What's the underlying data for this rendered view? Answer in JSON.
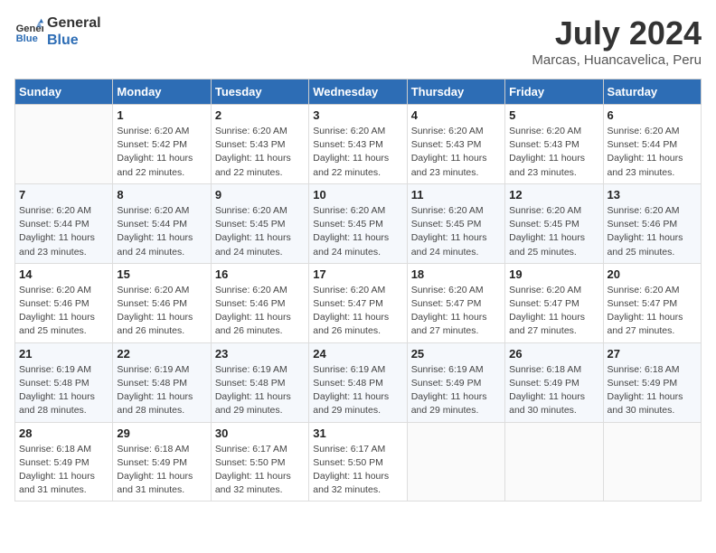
{
  "logo": {
    "line1": "General",
    "line2": "Blue"
  },
  "header": {
    "month_year": "July 2024",
    "location": "Marcas, Huancavelica, Peru"
  },
  "weekdays": [
    "Sunday",
    "Monday",
    "Tuesday",
    "Wednesday",
    "Thursday",
    "Friday",
    "Saturday"
  ],
  "weeks": [
    [
      {
        "day": "",
        "info": ""
      },
      {
        "day": "1",
        "info": "Sunrise: 6:20 AM\nSunset: 5:42 PM\nDaylight: 11 hours\nand 22 minutes."
      },
      {
        "day": "2",
        "info": "Sunrise: 6:20 AM\nSunset: 5:43 PM\nDaylight: 11 hours\nand 22 minutes."
      },
      {
        "day": "3",
        "info": "Sunrise: 6:20 AM\nSunset: 5:43 PM\nDaylight: 11 hours\nand 22 minutes."
      },
      {
        "day": "4",
        "info": "Sunrise: 6:20 AM\nSunset: 5:43 PM\nDaylight: 11 hours\nand 23 minutes."
      },
      {
        "day": "5",
        "info": "Sunrise: 6:20 AM\nSunset: 5:43 PM\nDaylight: 11 hours\nand 23 minutes."
      },
      {
        "day": "6",
        "info": "Sunrise: 6:20 AM\nSunset: 5:44 PM\nDaylight: 11 hours\nand 23 minutes."
      }
    ],
    [
      {
        "day": "7",
        "info": "Sunrise: 6:20 AM\nSunset: 5:44 PM\nDaylight: 11 hours\nand 23 minutes."
      },
      {
        "day": "8",
        "info": "Sunrise: 6:20 AM\nSunset: 5:44 PM\nDaylight: 11 hours\nand 24 minutes."
      },
      {
        "day": "9",
        "info": "Sunrise: 6:20 AM\nSunset: 5:45 PM\nDaylight: 11 hours\nand 24 minutes."
      },
      {
        "day": "10",
        "info": "Sunrise: 6:20 AM\nSunset: 5:45 PM\nDaylight: 11 hours\nand 24 minutes."
      },
      {
        "day": "11",
        "info": "Sunrise: 6:20 AM\nSunset: 5:45 PM\nDaylight: 11 hours\nand 24 minutes."
      },
      {
        "day": "12",
        "info": "Sunrise: 6:20 AM\nSunset: 5:45 PM\nDaylight: 11 hours\nand 25 minutes."
      },
      {
        "day": "13",
        "info": "Sunrise: 6:20 AM\nSunset: 5:46 PM\nDaylight: 11 hours\nand 25 minutes."
      }
    ],
    [
      {
        "day": "14",
        "info": "Sunrise: 6:20 AM\nSunset: 5:46 PM\nDaylight: 11 hours\nand 25 minutes."
      },
      {
        "day": "15",
        "info": "Sunrise: 6:20 AM\nSunset: 5:46 PM\nDaylight: 11 hours\nand 26 minutes."
      },
      {
        "day": "16",
        "info": "Sunrise: 6:20 AM\nSunset: 5:46 PM\nDaylight: 11 hours\nand 26 minutes."
      },
      {
        "day": "17",
        "info": "Sunrise: 6:20 AM\nSunset: 5:47 PM\nDaylight: 11 hours\nand 26 minutes."
      },
      {
        "day": "18",
        "info": "Sunrise: 6:20 AM\nSunset: 5:47 PM\nDaylight: 11 hours\nand 27 minutes."
      },
      {
        "day": "19",
        "info": "Sunrise: 6:20 AM\nSunset: 5:47 PM\nDaylight: 11 hours\nand 27 minutes."
      },
      {
        "day": "20",
        "info": "Sunrise: 6:20 AM\nSunset: 5:47 PM\nDaylight: 11 hours\nand 27 minutes."
      }
    ],
    [
      {
        "day": "21",
        "info": "Sunrise: 6:19 AM\nSunset: 5:48 PM\nDaylight: 11 hours\nand 28 minutes."
      },
      {
        "day": "22",
        "info": "Sunrise: 6:19 AM\nSunset: 5:48 PM\nDaylight: 11 hours\nand 28 minutes."
      },
      {
        "day": "23",
        "info": "Sunrise: 6:19 AM\nSunset: 5:48 PM\nDaylight: 11 hours\nand 29 minutes."
      },
      {
        "day": "24",
        "info": "Sunrise: 6:19 AM\nSunset: 5:48 PM\nDaylight: 11 hours\nand 29 minutes."
      },
      {
        "day": "25",
        "info": "Sunrise: 6:19 AM\nSunset: 5:49 PM\nDaylight: 11 hours\nand 29 minutes."
      },
      {
        "day": "26",
        "info": "Sunrise: 6:18 AM\nSunset: 5:49 PM\nDaylight: 11 hours\nand 30 minutes."
      },
      {
        "day": "27",
        "info": "Sunrise: 6:18 AM\nSunset: 5:49 PM\nDaylight: 11 hours\nand 30 minutes."
      }
    ],
    [
      {
        "day": "28",
        "info": "Sunrise: 6:18 AM\nSunset: 5:49 PM\nDaylight: 11 hours\nand 31 minutes."
      },
      {
        "day": "29",
        "info": "Sunrise: 6:18 AM\nSunset: 5:49 PM\nDaylight: 11 hours\nand 31 minutes."
      },
      {
        "day": "30",
        "info": "Sunrise: 6:17 AM\nSunset: 5:50 PM\nDaylight: 11 hours\nand 32 minutes."
      },
      {
        "day": "31",
        "info": "Sunrise: 6:17 AM\nSunset: 5:50 PM\nDaylight: 11 hours\nand 32 minutes."
      },
      {
        "day": "",
        "info": ""
      },
      {
        "day": "",
        "info": ""
      },
      {
        "day": "",
        "info": ""
      }
    ]
  ]
}
